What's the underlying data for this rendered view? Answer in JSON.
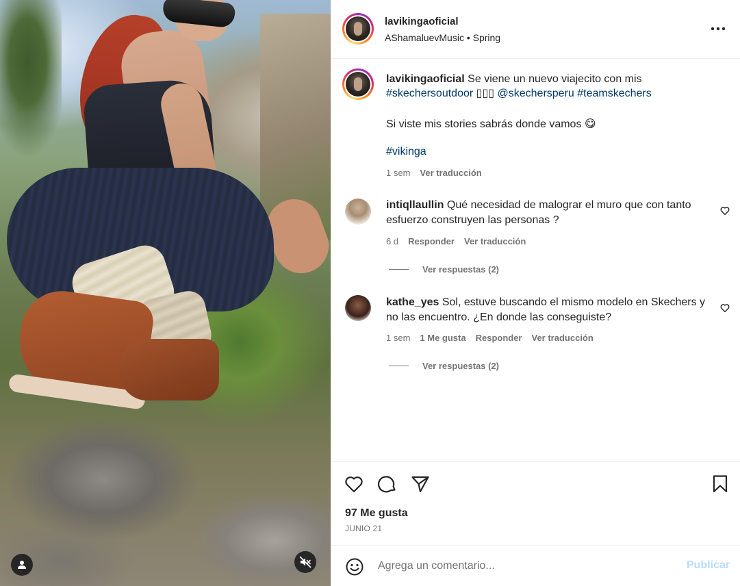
{
  "post": {
    "username": "lavikingaoficial",
    "audio_artist": "AShamaluevMusic",
    "audio_separator": "•",
    "audio_title": "Spring"
  },
  "caption": {
    "username": "lavikingaoficial",
    "text_before": "Se viene un nuevo viajecito con mis",
    "hashtag_outdoor": "#skechersoutdoor",
    "emoji_glyphs": "▯▯▯",
    "mention": "@skechersperu",
    "hashtag_team": "#teamskechers",
    "line2": "Si viste mis stories sabrás donde vamos",
    "line2_emoji": "😋",
    "hashtag_viking": "#vikinga",
    "time": "1 sem",
    "translate": "Ver traducción"
  },
  "comments": [
    {
      "username": "intiqllaullin",
      "text": "Qué necesidad de malograr el muro que con tanto esfuerzo construyen las personas ?",
      "time": "6 d",
      "likes": "",
      "reply": "Responder",
      "translate": "Ver traducción",
      "view_replies": "Ver respuestas (2)"
    },
    {
      "username": "kathe_yes",
      "text": "Sol, estuve buscando el mismo modelo en Skechers y no las encuentro. ¿En donde las conseguiste?",
      "time": "1 sem",
      "likes": "1 Me gusta",
      "reply": "Responder",
      "translate": "Ver traducción",
      "view_replies": "Ver respuestas (2)"
    }
  ],
  "stats": {
    "likes": "97 Me gusta",
    "date": "JUNIO 21"
  },
  "add_comment": {
    "placeholder": "Agrega un comentario...",
    "post_label": "Publicar"
  },
  "icons": {
    "more": "more-horizontal-icon",
    "heart": "heart-icon",
    "comment": "comment-bubble-icon",
    "share": "paper-plane-icon",
    "save": "bookmark-icon",
    "emoji": "smiley-icon",
    "user": "user-icon",
    "mute": "speaker-muted-icon"
  },
  "colors": {
    "link": "#00376b",
    "muted_text": "#737373",
    "publish_disabled": "#b9dcfb"
  }
}
